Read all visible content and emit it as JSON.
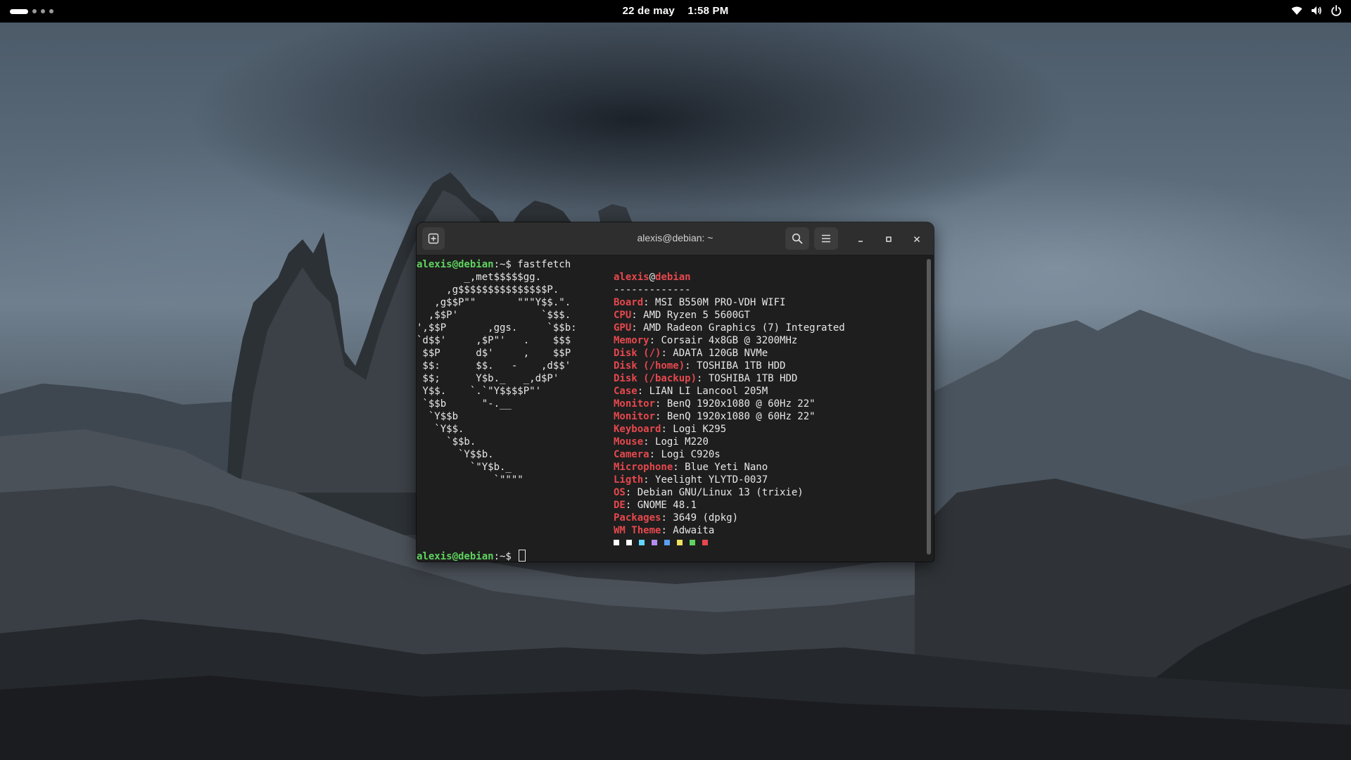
{
  "topbar": {
    "date": "22 de may",
    "time": "1:58 PM",
    "icons": [
      "wifi-icon",
      "volume-icon",
      "power-icon"
    ]
  },
  "window": {
    "title": "alexis@debian: ~",
    "buttons": [
      "new-tab-icon",
      "search-icon",
      "menu-icon",
      "minimize-icon",
      "maximize-icon",
      "close-icon"
    ]
  },
  "terminal": {
    "prompt_user_host": "alexis@debian",
    "prompt_suffix": ":~$ ",
    "command": "fastfetch",
    "ascii_art": [
      "        _,met$$$$$gg.",
      "     ,g$$$$$$$$$$$$$$$P.",
      "   ,g$$P\"\"       \"\"\"Y$$.\".",
      "  ,$$P'              `$$$.",
      "',$$P       ,ggs.     `$$b:",
      "`d$$'     ,$P\"'   .    $$$",
      " $$P      d$'     ,    $$P",
      " $$:      $$.   -    ,d$$'",
      " $$;      Y$b._   _,d$P'",
      " Y$$.    `.`\"Y$$$$P\"'",
      " `$$b      \"-.__",
      "  `Y$$b",
      "   `Y$$.",
      "     `$$b.",
      "       `Y$$b.",
      "         `\"Y$b._",
      "             `\"\"\"\""
    ],
    "info_user": "alexis",
    "info_at": "@",
    "info_host": "debian",
    "separator": "-------------",
    "info": [
      {
        "key": "Board",
        "value": "MSI B550M PRO-VDH WIFI"
      },
      {
        "key": "CPU",
        "value": "AMD Ryzen 5 5600GT"
      },
      {
        "key": "GPU",
        "value": "AMD Radeon Graphics (7) Integrated"
      },
      {
        "key": "Memory",
        "value": "Corsair 4x8GB @ 3200MHz"
      },
      {
        "key": "Disk (/)",
        "value": "ADATA 120GB NVMe"
      },
      {
        "key": "Disk (/home)",
        "value": "TOSHIBA 1TB HDD"
      },
      {
        "key": "Disk (/backup)",
        "value": "TOSHIBA 1TB HDD"
      },
      {
        "key": "Case",
        "value": "LIAN LI Lancool 205M"
      },
      {
        "key": "Monitor",
        "value": "BenQ 1920x1080 @ 60Hz 22\""
      },
      {
        "key": "Monitor",
        "value": "BenQ 1920x1080 @ 60Hz 22\""
      },
      {
        "key": "Keyboard",
        "value": "Logi K295"
      },
      {
        "key": "Mouse",
        "value": "Logi M220"
      },
      {
        "key": "Camera",
        "value": "Logi C920s"
      },
      {
        "key": "Microphone",
        "value": "Blue Yeti Nano"
      },
      {
        "key": "Ligth",
        "value": "Yeelight YLYTD-0037"
      },
      {
        "key": "OS",
        "value": "Debian GNU/Linux 13 (trixie)"
      },
      {
        "key": "DE",
        "value": "GNOME 48.1"
      },
      {
        "key": "Packages",
        "value": "3649 (dpkg)"
      },
      {
        "key": "WM Theme",
        "value": "Adwaita"
      }
    ],
    "palette": [
      "#ffffff",
      "#ffffff",
      "#5fd7ff",
      "#b48cf0",
      "#5a9ef0",
      "#f0e060",
      "#5fd35f",
      "#e5484d"
    ]
  }
}
